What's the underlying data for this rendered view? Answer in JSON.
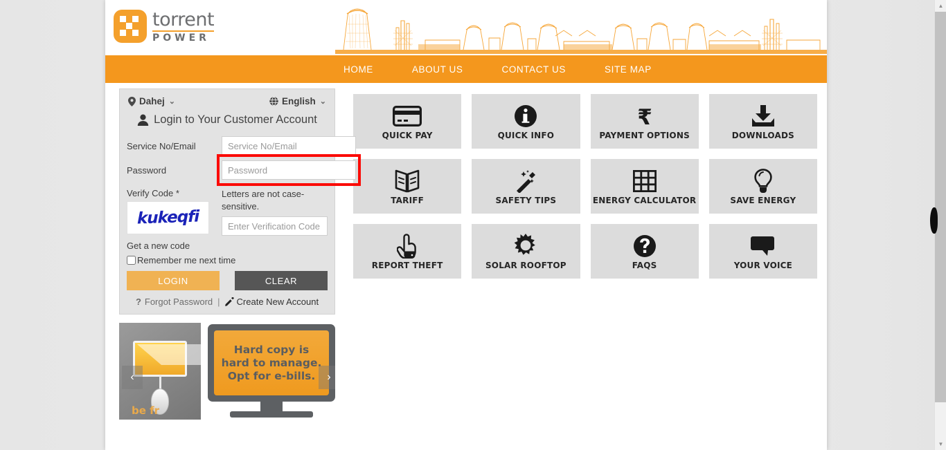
{
  "brand": {
    "name_primary": "torrent",
    "name_secondary": "POWER"
  },
  "nav": {
    "items": [
      {
        "label": "HOME"
      },
      {
        "label": "ABOUT US"
      },
      {
        "label": "CONTACT US"
      },
      {
        "label": "SITE MAP"
      }
    ]
  },
  "login": {
    "location": {
      "icon": "location-pin-icon",
      "value": "Dahej",
      "chevron": "⌄"
    },
    "language": {
      "icon": "globe-icon",
      "value": "English",
      "chevron": "⌄"
    },
    "title": "Login to Your Customer Account",
    "title_icon": "person-icon",
    "service_label": "Service No/Email",
    "service_placeholder": "Service No/Email",
    "service_value": "",
    "password_label": "Password",
    "password_placeholder": "Password",
    "password_value": "",
    "verify_label": "Verify Code *",
    "captcha_text": "kukeqfi",
    "case_note": "Letters are not case-sensitive.",
    "verify_placeholder": "Enter Verification Code",
    "verify_value": "",
    "new_code_link": "Get a new code",
    "remember_label": "Remember me next time",
    "login_button": "LOGIN",
    "clear_button": "CLEAR",
    "forgot_prefix": "?",
    "forgot_link": "Forgot Password",
    "separator": "|",
    "create_icon": "pencil-icon",
    "create_link": "Create New Account",
    "highlight_color": "#fb0b06"
  },
  "carousel": {
    "prev_label": "‹",
    "next_label": "›",
    "slide_a_caption": "be fr",
    "slide_b_line1": "Hard copy is",
    "slide_b_line2": "hard to manage.",
    "slide_b_line3": "Opt for e-bills."
  },
  "tiles": [
    {
      "label": "QUICK PAY",
      "icon": "credit-card-icon"
    },
    {
      "label": "QUICK INFO",
      "icon": "info-circle-icon"
    },
    {
      "label": "PAYMENT OPTIONS",
      "icon": "rupee-icon"
    },
    {
      "label": "DOWNLOADS",
      "icon": "download-icon"
    },
    {
      "label": "TARIFF",
      "icon": "open-book-icon"
    },
    {
      "label": "SAFETY TIPS",
      "icon": "magic-wand-icon"
    },
    {
      "label": "ENERGY CALCULATOR",
      "icon": "grid-table-icon"
    },
    {
      "label": "SAVE ENERGY",
      "icon": "light-bulb-icon"
    },
    {
      "label": "REPORT THEFT",
      "icon": "pointing-hand-icon"
    },
    {
      "label": "SOLAR ROOFTOP",
      "icon": "sun-icon"
    },
    {
      "label": "FAQS",
      "icon": "question-circle-icon"
    },
    {
      "label": "YOUR VOICE",
      "icon": "speech-bubble-icon"
    }
  ],
  "colors": {
    "brand_orange": "#f4971d",
    "logo_orange": "#f4a02c",
    "login_button": "#f0b253",
    "clear_button": "#565656",
    "tile_bg": "#dcdcdc",
    "captcha_blue": "#1b23b8"
  },
  "scrollbar": {
    "up_arrow": "▲",
    "down_arrow": "▼"
  }
}
